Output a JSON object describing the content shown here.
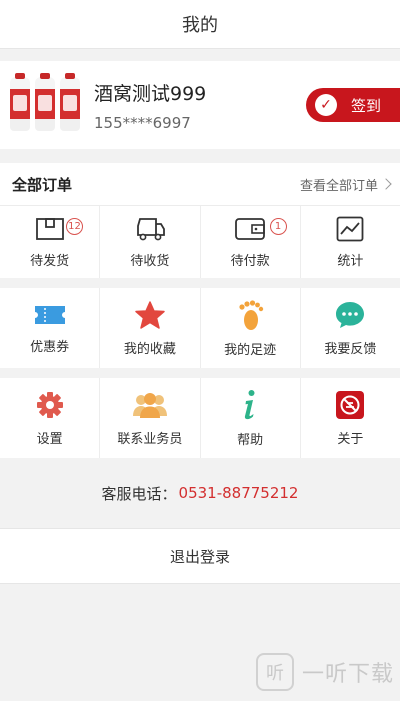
{
  "header": {
    "title": "我的"
  },
  "profile": {
    "name": "酒窝测试999",
    "phone": "155****6997",
    "signin_label": "签到"
  },
  "orders": {
    "title": "全部订单",
    "view_all": "查看全部订单",
    "items": [
      {
        "label": "待发货",
        "icon": "box-icon",
        "badge": "12"
      },
      {
        "label": "待收货",
        "icon": "truck-icon",
        "badge": ""
      },
      {
        "label": "待付款",
        "icon": "wallet-icon",
        "badge": "1"
      },
      {
        "label": "统计",
        "icon": "chart-icon",
        "badge": ""
      }
    ]
  },
  "services": {
    "items": [
      {
        "label": "优惠券",
        "icon": "coupon-icon"
      },
      {
        "label": "我的收藏",
        "icon": "star-icon"
      },
      {
        "label": "我的足迹",
        "icon": "footprint-icon"
      },
      {
        "label": "我要反馈",
        "icon": "feedback-icon"
      }
    ]
  },
  "tools": {
    "items": [
      {
        "label": "设置",
        "icon": "gear-icon"
      },
      {
        "label": "联系业务员",
        "icon": "contacts-icon"
      },
      {
        "label": "帮助",
        "icon": "info-icon"
      },
      {
        "label": "关于",
        "icon": "about-icon"
      }
    ]
  },
  "hotline": {
    "label": "客服电话：",
    "number": "0531-88775212"
  },
  "logout": {
    "label": "退出登录"
  },
  "watermark": {
    "glyph": "听",
    "text": "一听下载"
  },
  "colors": {
    "accent": "#c8161d",
    "coupon": "#3a9be0",
    "star": "#e2473e",
    "foot": "#f3a33b",
    "feedback": "#2bb39a",
    "gear": "#e05a4e",
    "contacts": "#f0a64a",
    "info": "#2db38a"
  }
}
